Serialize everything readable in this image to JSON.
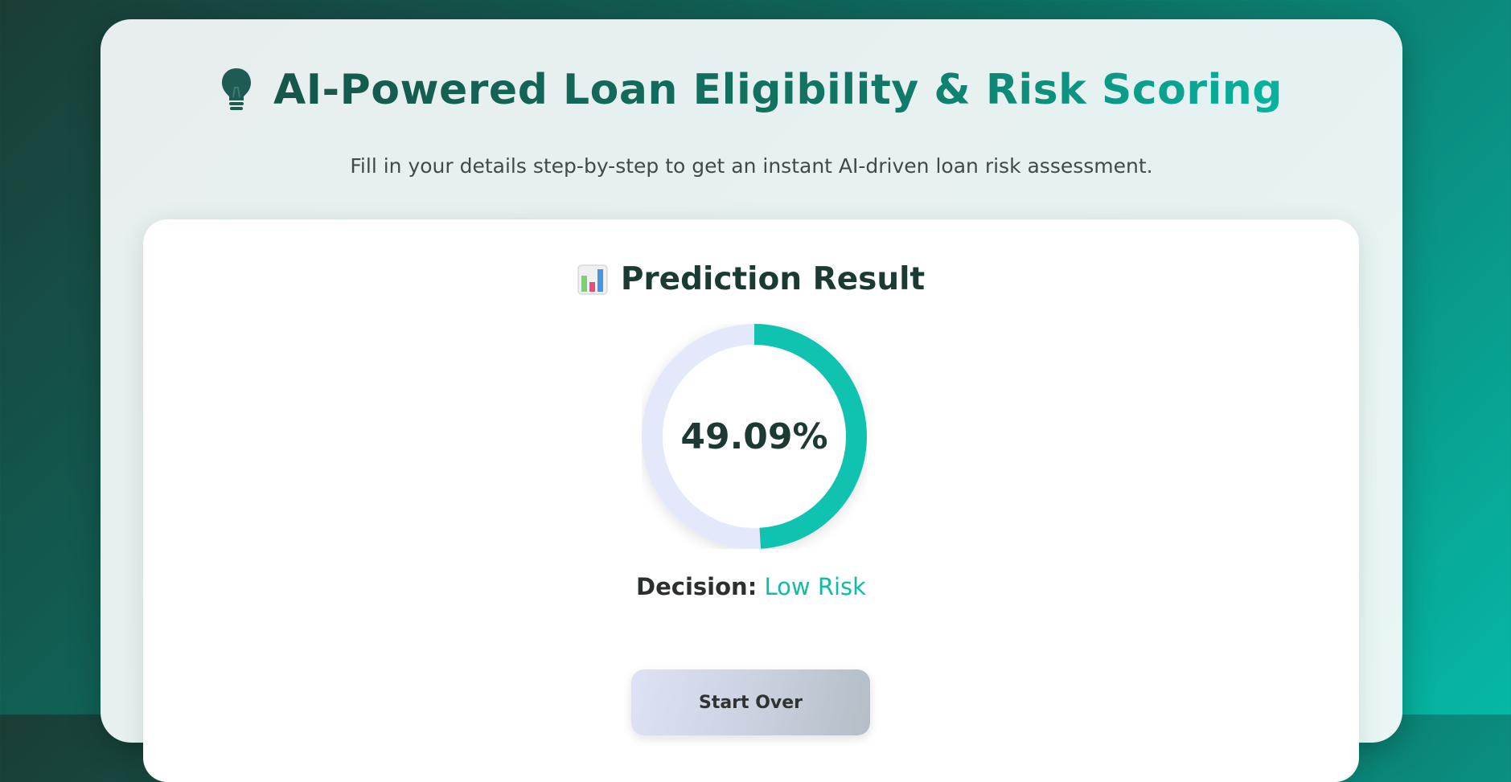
{
  "header": {
    "icon": "lightbulb-icon",
    "title": "AI-Powered Loan Eligibility & Risk Scoring",
    "subtitle": "Fill in your details step-by-step to get an instant AI-driven loan risk assessment."
  },
  "result": {
    "icon": "bar-chart-icon",
    "title": "Prediction Result",
    "score_text": "49.09%",
    "score_fraction": 0.4909,
    "decision_label": "Decision:",
    "decision_value": "Low Risk"
  },
  "actions": {
    "start_over_label": "Start Over"
  },
  "colors": {
    "accent": "#11bba8",
    "gauge_track": "#e4e8fb",
    "dark_text": "#1b3a33"
  }
}
